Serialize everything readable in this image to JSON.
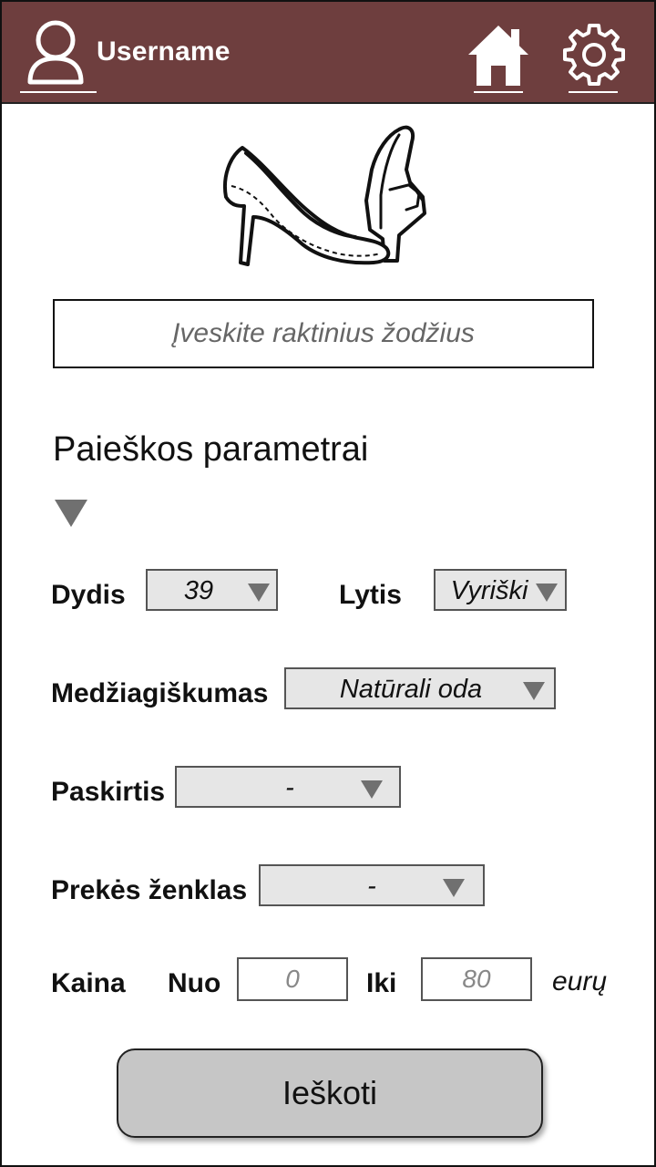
{
  "header": {
    "username": "Username",
    "icons": {
      "user": "user-icon",
      "home": "home-icon",
      "settings": "gear-icon"
    },
    "bar_color": "#6e3e3e"
  },
  "search": {
    "placeholder": "Įveskite raktinius žodžius"
  },
  "params": {
    "title": "Paieškos parametrai",
    "size": {
      "label": "Dydis",
      "value": "39"
    },
    "gender": {
      "label": "Lytis",
      "value": "Vyriški"
    },
    "material": {
      "label": "Medžiagiškumas",
      "value": "Natūrali oda"
    },
    "purpose": {
      "label": "Paskirtis",
      "value": "-"
    },
    "brand": {
      "label": "Prekės ženklas",
      "value": "-"
    },
    "price": {
      "label": "Kaina",
      "from_label": "Nuo",
      "from_value": "0",
      "to_label": "Iki",
      "to_value": "80",
      "unit": "eurų"
    }
  },
  "actions": {
    "search_button": "Ieškoti"
  }
}
